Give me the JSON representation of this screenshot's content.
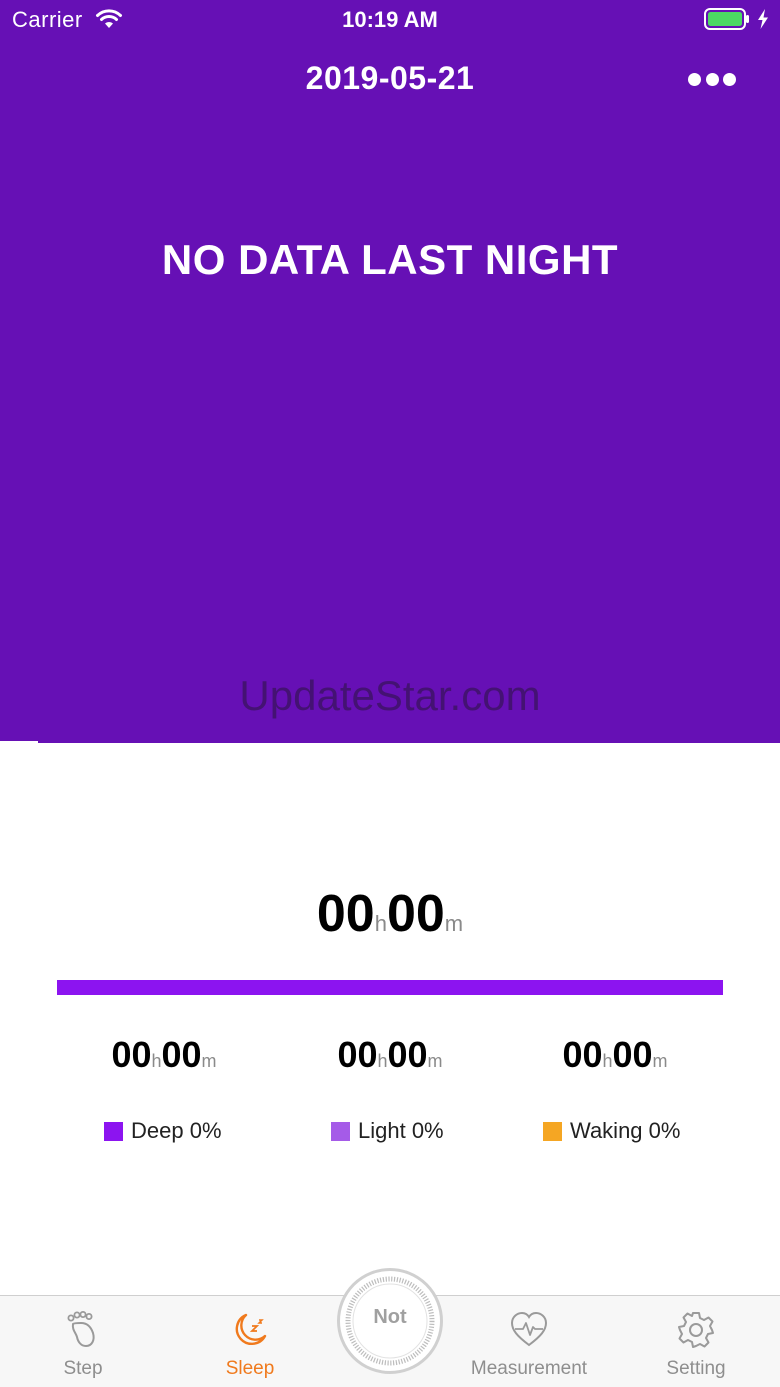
{
  "status_bar": {
    "carrier": "Carrier",
    "time": "10:19 AM"
  },
  "header": {
    "date": "2019-05-21",
    "message": "NO DATA LAST NIGHT"
  },
  "watermark": "UpdateStar.com",
  "total": {
    "hours": "00",
    "hours_unit": "h",
    "minutes": "00",
    "minutes_unit": "m"
  },
  "stats": [
    {
      "hours": "00",
      "hours_unit": "h",
      "minutes": "00",
      "minutes_unit": "m",
      "legend": "Deep 0%",
      "color": "#8c14f0"
    },
    {
      "hours": "00",
      "hours_unit": "h",
      "minutes": "00",
      "minutes_unit": "m",
      "legend": "Light 0%",
      "color": "#a55be8"
    },
    {
      "hours": "00",
      "hours_unit": "h",
      "minutes": "00",
      "minutes_unit": "m",
      "legend": "Waking 0%",
      "color": "#f5a623"
    }
  ],
  "tabbar": {
    "step": "Step",
    "sleep": "Sleep",
    "center": "Not",
    "measurement": "Measurement",
    "setting": "Setting"
  },
  "colors": {
    "header_bg": "#6610b5",
    "accent": "#f07a1d",
    "bar": "#8c14f0",
    "battery": "#4cd964"
  },
  "icons": [
    "wifi-icon",
    "battery-icon",
    "charging-icon",
    "more-icon",
    "footprint-icon",
    "moon-icon",
    "heart-rate-icon",
    "gear-icon"
  ]
}
